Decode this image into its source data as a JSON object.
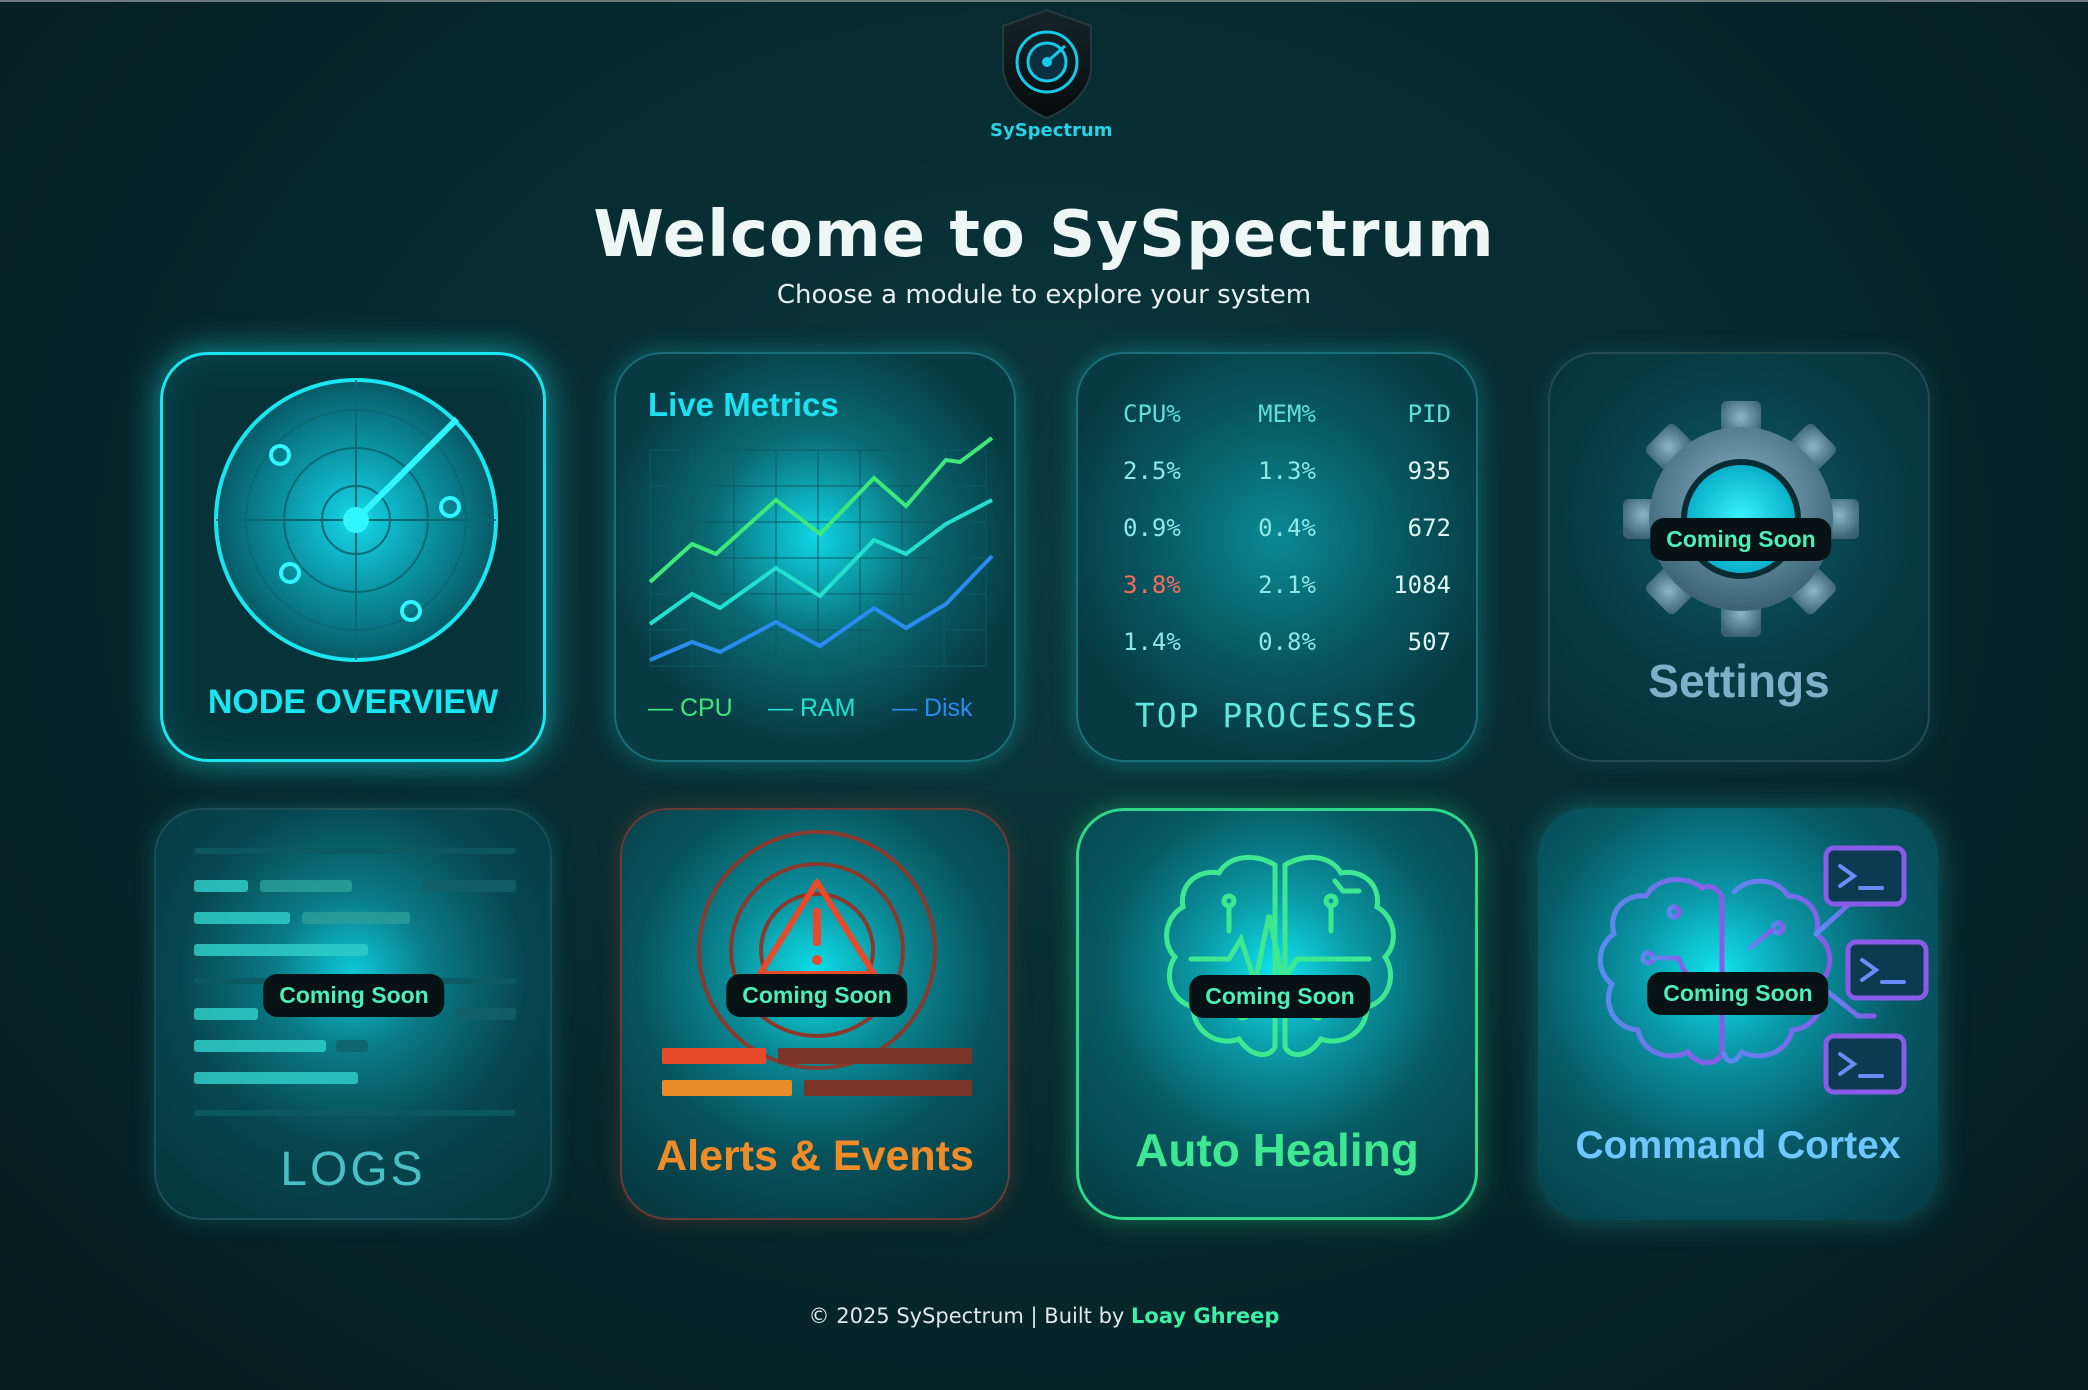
{
  "brand": {
    "name": "SySpectrum",
    "icon": "radar-shield-icon"
  },
  "header": {
    "title": "Welcome to SySpectrum",
    "subtitle": "Choose a module to explore your system"
  },
  "modules": {
    "node_overview": {
      "label": "NODE OVERVIEW",
      "icon": "radar-icon",
      "accent": "#19e6f0"
    },
    "live_metrics": {
      "label": "Live Metrics",
      "legend": [
        {
          "name": "CPU",
          "color": "#3ee87a"
        },
        {
          "name": "RAM",
          "color": "#22e0d0"
        },
        {
          "name": "Disk",
          "color": "#2a8cf0"
        }
      ]
    },
    "top_processes": {
      "label": "TOP PROCESSES",
      "columns": [
        "CPU%",
        "MEM%",
        "PID"
      ],
      "rows": [
        {
          "cpu": "2.5%",
          "mem": "1.3%",
          "pid": "935"
        },
        {
          "cpu": "0.9%",
          "mem": "0.4%",
          "pid": "672"
        },
        {
          "cpu": "3.8%",
          "mem": "2.1%",
          "pid": "1084"
        },
        {
          "cpu": "1.4%",
          "mem": "0.8%",
          "pid": "507"
        }
      ],
      "highlight_color": "#ff6b5a"
    },
    "settings": {
      "label": "Settings",
      "badge": "Coming Soon",
      "icon": "gear-icon"
    },
    "logs": {
      "label": "LOGS",
      "badge": "Coming Soon",
      "icon": "log-lines-icon"
    },
    "alerts": {
      "label": "Alerts & Events",
      "badge": "Coming Soon",
      "icon": "warning-icon",
      "accent": "#f08c28"
    },
    "auto_healing": {
      "label": "Auto Healing",
      "badge": "Coming Soon",
      "icon": "brain-circuit-icon",
      "accent": "#3ee890"
    },
    "command_cortex": {
      "label": "Command Cortex",
      "badge": "Coming Soon",
      "icon": "brain-terminal-icon",
      "accent": "#6ec8ff"
    }
  },
  "footer": {
    "text": "© 2025 SySpectrum | Built by",
    "author": "Loay Ghreep"
  }
}
